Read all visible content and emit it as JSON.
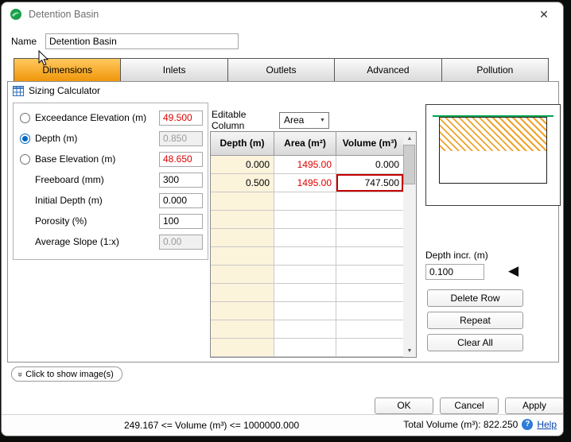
{
  "window": {
    "title": "Detention Basin"
  },
  "icons": {
    "close": "✕",
    "combo_arrow": "▼",
    "scroll_up": "▲",
    "scroll_down": "▼",
    "apply_arrow": "◀",
    "show_images_chevrons": "»",
    "help_qmark": "?"
  },
  "colors": {
    "active_tab_orange": "#F0960B",
    "error_red": "#DE0000",
    "radio_blue": "#0067C0",
    "ground_green": "#00A651",
    "editable_cream": "#FCF3DB"
  },
  "name_field": {
    "label": "Name",
    "value": "Detention Basin"
  },
  "tabs": [
    {
      "label": "Dimensions"
    },
    {
      "label": "Inlets"
    },
    {
      "label": "Outlets"
    },
    {
      "label": "Advanced"
    },
    {
      "label": "Pollution"
    }
  ],
  "sizing": {
    "title": "Sizing Calculator"
  },
  "params": [
    {
      "label": "Exceedance Elevation (m)",
      "value": "49.500"
    },
    {
      "label": "Depth (m)",
      "value": "0.850"
    },
    {
      "label": "Base Elevation (m)",
      "value": "48.650"
    },
    {
      "label": "Freeboard (mm)",
      "value": "300"
    },
    {
      "label": "Initial Depth (m)",
      "value": "0.000"
    },
    {
      "label": "Porosity (%)",
      "value": "100"
    },
    {
      "label": "Average Slope (1:x)",
      "value": "0.00"
    }
  ],
  "editable_column": {
    "label": "Editable Column",
    "value": "Area"
  },
  "table": {
    "headers": [
      "Depth (m)",
      "Area (m²)",
      "Volume (m³)"
    ],
    "rows": [
      {
        "depth": "0.000",
        "area": "1495.00",
        "volume": "0.000"
      },
      {
        "depth": "0.500",
        "area": "1495.00",
        "volume": "747.500"
      }
    ]
  },
  "depth_incr": {
    "label": "Depth incr. (m)",
    "value": "0.100"
  },
  "side_buttons": {
    "delete_row": "Delete Row",
    "repeat": "Repeat",
    "clear_all": "Clear All"
  },
  "show_images": {
    "label": "Click to show image(s)"
  },
  "dialog_buttons": {
    "ok": "OK",
    "cancel": "Cancel",
    "apply": "Apply"
  },
  "status": {
    "range": "249.167 <= Volume (m³) <= 1000000.000",
    "total": "Total Volume (m³): 822.250",
    "help": "Help"
  }
}
